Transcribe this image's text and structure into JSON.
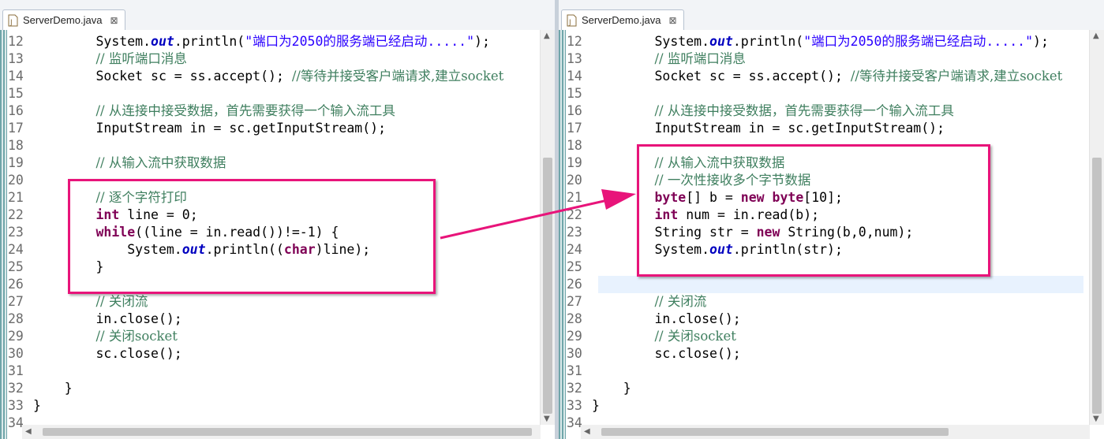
{
  "left_editor": {
    "tab_label": "ServerDemo.java",
    "close_glyph": "⊠",
    "lines": [
      {
        "num": "12",
        "code": [
          {
            "t": "        System."
          },
          {
            "t": "out",
            "c": "fld"
          },
          {
            "t": ".println("
          },
          {
            "t": "\"端口为2050的服务端已经启动.....\"",
            "c": "str"
          },
          {
            "t": ");"
          }
        ]
      },
      {
        "num": "13",
        "code": [
          {
            "t": "        "
          },
          {
            "t": "// 监听端口消息",
            "c": "cm"
          }
        ]
      },
      {
        "num": "14",
        "code": [
          {
            "t": "        Socket sc = ss.accept(); "
          },
          {
            "t": "//等待并接受客户端请求,建立socket",
            "c": "cm"
          }
        ]
      },
      {
        "num": "15",
        "code": []
      },
      {
        "num": "16",
        "code": [
          {
            "t": "        "
          },
          {
            "t": "// 从连接中接受数据，首先需要获得一个输入流工具",
            "c": "cm"
          }
        ]
      },
      {
        "num": "17",
        "code": [
          {
            "t": "        InputStream in = sc.getInputStream();"
          }
        ]
      },
      {
        "num": "18",
        "code": []
      },
      {
        "num": "19",
        "code": [
          {
            "t": "        "
          },
          {
            "t": "// 从输入流中获取数据",
            "c": "cm"
          }
        ]
      },
      {
        "num": "20",
        "code": []
      },
      {
        "num": "21",
        "code": [
          {
            "t": "        "
          },
          {
            "t": "// 逐个字符打印",
            "c": "cm"
          }
        ]
      },
      {
        "num": "22",
        "code": [
          {
            "t": "        "
          },
          {
            "t": "int",
            "c": "kw"
          },
          {
            "t": " line = 0;"
          }
        ]
      },
      {
        "num": "23",
        "code": [
          {
            "t": "        "
          },
          {
            "t": "while",
            "c": "kw"
          },
          {
            "t": "((line = in.read())!=-1) {"
          }
        ]
      },
      {
        "num": "24",
        "code": [
          {
            "t": "            System."
          },
          {
            "t": "out",
            "c": "fld"
          },
          {
            "t": ".println(("
          },
          {
            "t": "char",
            "c": "kw"
          },
          {
            "t": ")line);"
          }
        ]
      },
      {
        "num": "25",
        "code": [
          {
            "t": "        }"
          }
        ]
      },
      {
        "num": "26",
        "code": []
      },
      {
        "num": "27",
        "code": [
          {
            "t": "        "
          },
          {
            "t": "// 关闭流",
            "c": "cm"
          }
        ]
      },
      {
        "num": "28",
        "code": [
          {
            "t": "        in.close();"
          }
        ]
      },
      {
        "num": "29",
        "code": [
          {
            "t": "        "
          },
          {
            "t": "// 关闭socket",
            "c": "cm"
          }
        ]
      },
      {
        "num": "30",
        "code": [
          {
            "t": "        sc.close();"
          }
        ]
      },
      {
        "num": "31",
        "code": []
      },
      {
        "num": "32",
        "code": [
          {
            "t": "    }"
          }
        ]
      },
      {
        "num": "33",
        "code": [
          {
            "t": "}"
          }
        ]
      },
      {
        "num": "34",
        "code": []
      }
    ]
  },
  "right_editor": {
    "tab_label": "ServerDemo.java",
    "close_glyph": "⊠",
    "highlighted_line": "26",
    "lines": [
      {
        "num": "12",
        "code": [
          {
            "t": "        System."
          },
          {
            "t": "out",
            "c": "fld"
          },
          {
            "t": ".println("
          },
          {
            "t": "\"端口为2050的服务端已经启动.....\"",
            "c": "str"
          },
          {
            "t": ");"
          }
        ]
      },
      {
        "num": "13",
        "code": [
          {
            "t": "        "
          },
          {
            "t": "// 监听端口消息",
            "c": "cm"
          }
        ]
      },
      {
        "num": "14",
        "code": [
          {
            "t": "        Socket sc = ss.accept(); "
          },
          {
            "t": "//等待并接受客户端请求,建立socket",
            "c": "cm"
          }
        ]
      },
      {
        "num": "15",
        "code": []
      },
      {
        "num": "16",
        "code": [
          {
            "t": "        "
          },
          {
            "t": "// 从连接中接受数据，首先需要获得一个输入流工具",
            "c": "cm"
          }
        ]
      },
      {
        "num": "17",
        "code": [
          {
            "t": "        InputStream in = sc.getInputStream();"
          }
        ]
      },
      {
        "num": "18",
        "code": []
      },
      {
        "num": "19",
        "code": [
          {
            "t": "        "
          },
          {
            "t": "// 从输入流中获取数据",
            "c": "cm"
          }
        ]
      },
      {
        "num": "20",
        "code": [
          {
            "t": "        "
          },
          {
            "t": "// 一次性接收多个字节数据",
            "c": "cm"
          }
        ]
      },
      {
        "num": "21",
        "code": [
          {
            "t": "        "
          },
          {
            "t": "byte",
            "c": "kw"
          },
          {
            "t": "[] b = "
          },
          {
            "t": "new",
            "c": "kw"
          },
          {
            "t": " "
          },
          {
            "t": "byte",
            "c": "kw"
          },
          {
            "t": "[10];"
          }
        ]
      },
      {
        "num": "22",
        "code": [
          {
            "t": "        "
          },
          {
            "t": "int",
            "c": "kw"
          },
          {
            "t": " num = in.read(b);"
          }
        ]
      },
      {
        "num": "23",
        "code": [
          {
            "t": "        String str = "
          },
          {
            "t": "new",
            "c": "kw"
          },
          {
            "t": " String(b,0,num);"
          }
        ]
      },
      {
        "num": "24",
        "code": [
          {
            "t": "        System."
          },
          {
            "t": "out",
            "c": "fld"
          },
          {
            "t": ".println(str);"
          }
        ]
      },
      {
        "num": "25",
        "code": []
      },
      {
        "num": "26",
        "code": []
      },
      {
        "num": "27",
        "code": [
          {
            "t": "        "
          },
          {
            "t": "// 关闭流",
            "c": "cm"
          }
        ]
      },
      {
        "num": "28",
        "code": [
          {
            "t": "        in.close();"
          }
        ]
      },
      {
        "num": "29",
        "code": [
          {
            "t": "        "
          },
          {
            "t": "// 关闭socket",
            "c": "cm"
          }
        ]
      },
      {
        "num": "30",
        "code": [
          {
            "t": "        sc.close();"
          }
        ]
      },
      {
        "num": "31",
        "code": []
      },
      {
        "num": "32",
        "code": [
          {
            "t": "    }"
          }
        ]
      },
      {
        "num": "33",
        "code": [
          {
            "t": "}"
          }
        ]
      },
      {
        "num": "34",
        "code": []
      }
    ]
  },
  "colors": {
    "callout": "#e8147a",
    "keyword": "#7f0055",
    "comment": "#3f7f5f",
    "string": "#2a00ff",
    "field": "#0000c0",
    "current_line": "#e8f2fe"
  }
}
